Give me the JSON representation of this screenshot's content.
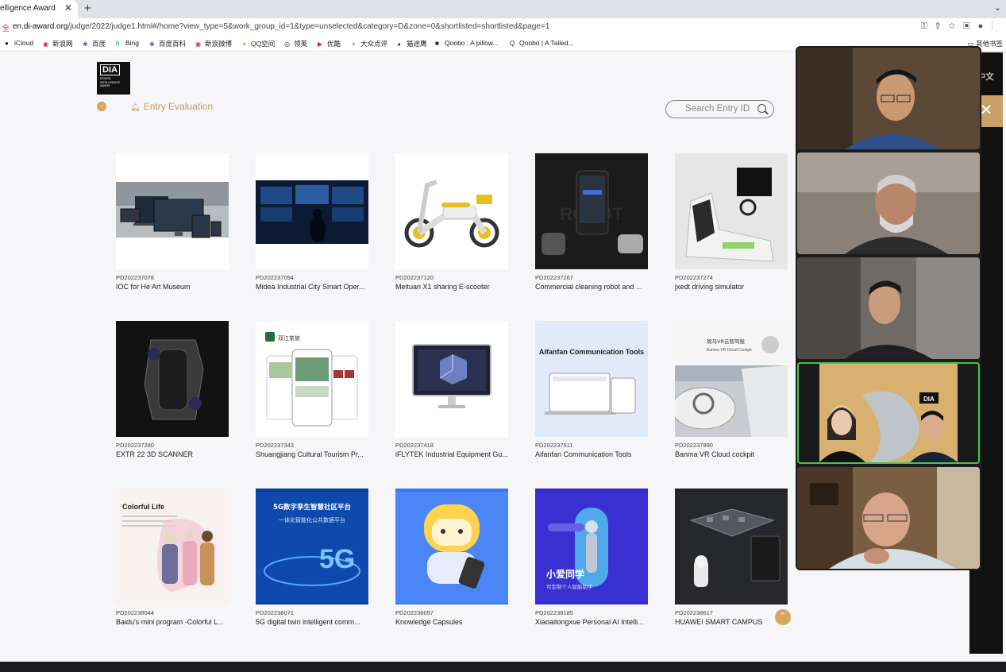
{
  "browser": {
    "tab_title": "elligence Award",
    "url_domain": "en.di-award.org",
    "url_path": "/judge/2022/judge1.html#/home?view_type=5&work_group_id=1&type=unselected&category=D&zone=0&shortlisted=shortlisted&page=1",
    "bookmarks": [
      "iCloud",
      "新浪网",
      "百度",
      "Bing",
      "百度百科",
      "新浪微博",
      "QQ空间",
      "领英",
      "优酷",
      "大众点评",
      "猫途鹰",
      "Qoobo : A pillow...",
      "Qoobo | A Tailed..."
    ],
    "other_bookmarks": "其他书签"
  },
  "header": {
    "logo_text": "DIA",
    "logo_subtitle": "DESIGN INTELLIGENCE AWARD",
    "entry_evaluation": "Entry Evaluation",
    "search_placeholder": "Search Entry ID"
  },
  "side_panel": {
    "language": "中文"
  },
  "entries": [
    {
      "id": "PD202237078",
      "title": "IOC for He Art Museum"
    },
    {
      "id": "PD202237094",
      "title": "Midea Industrial City Smart Oper..."
    },
    {
      "id": "PD202237120",
      "title": "Meituan X1 sharing E-scooter"
    },
    {
      "id": "PD202237267",
      "title": "Commercial cleaning robot and ..."
    },
    {
      "id": "PD202237274",
      "title": "jxedt driving simulator"
    },
    {
      "id": "PD202237280",
      "title": "EXTR 22 3D SCANNER"
    },
    {
      "id": "PD202237343",
      "title": "Shuangjiang Cultural Tourism Pr..."
    },
    {
      "id": "PD202237418",
      "title": "iFLYTEK Industrial Equipment Gu..."
    },
    {
      "id": "PD202237511",
      "title": "Aifanfan Communication Tools"
    },
    {
      "id": "PD202237890",
      "title": "Banma VR Cloud cockpit"
    },
    {
      "id": "PD202238044",
      "title": "Baidu's mini program -Colorful L..."
    },
    {
      "id": "PD202238071",
      "title": "5G digital twin intelligent comm..."
    },
    {
      "id": "PD202238097",
      "title": "Knowledge Capsules"
    },
    {
      "id": "PD202238185",
      "title": "Xiaoaitongxue Personal AI Intelli..."
    },
    {
      "id": "PD202238617",
      "title": "HUAWEI SMART CAMPUS"
    }
  ],
  "thumb_text": {
    "robot_word": "ROBOT",
    "shuangjiang": "双江茶旅",
    "aifanfan_title": "Aifanfan Communication Tools",
    "banma_title": "斑马VR云智驾舱",
    "banma_sub": "Banma VR Cloud Cockpit",
    "colorful_title": "Colorful Life",
    "fiveg_title": "5G数字孪生智慧社区平台",
    "fiveg_sub": "一体化智能化公共数据平台",
    "fiveg_big": "5G",
    "xiaoai_title": "小爱同学",
    "xiaoai_sub": "可定制个人智能助手",
    "dia_badge": "DIA"
  }
}
